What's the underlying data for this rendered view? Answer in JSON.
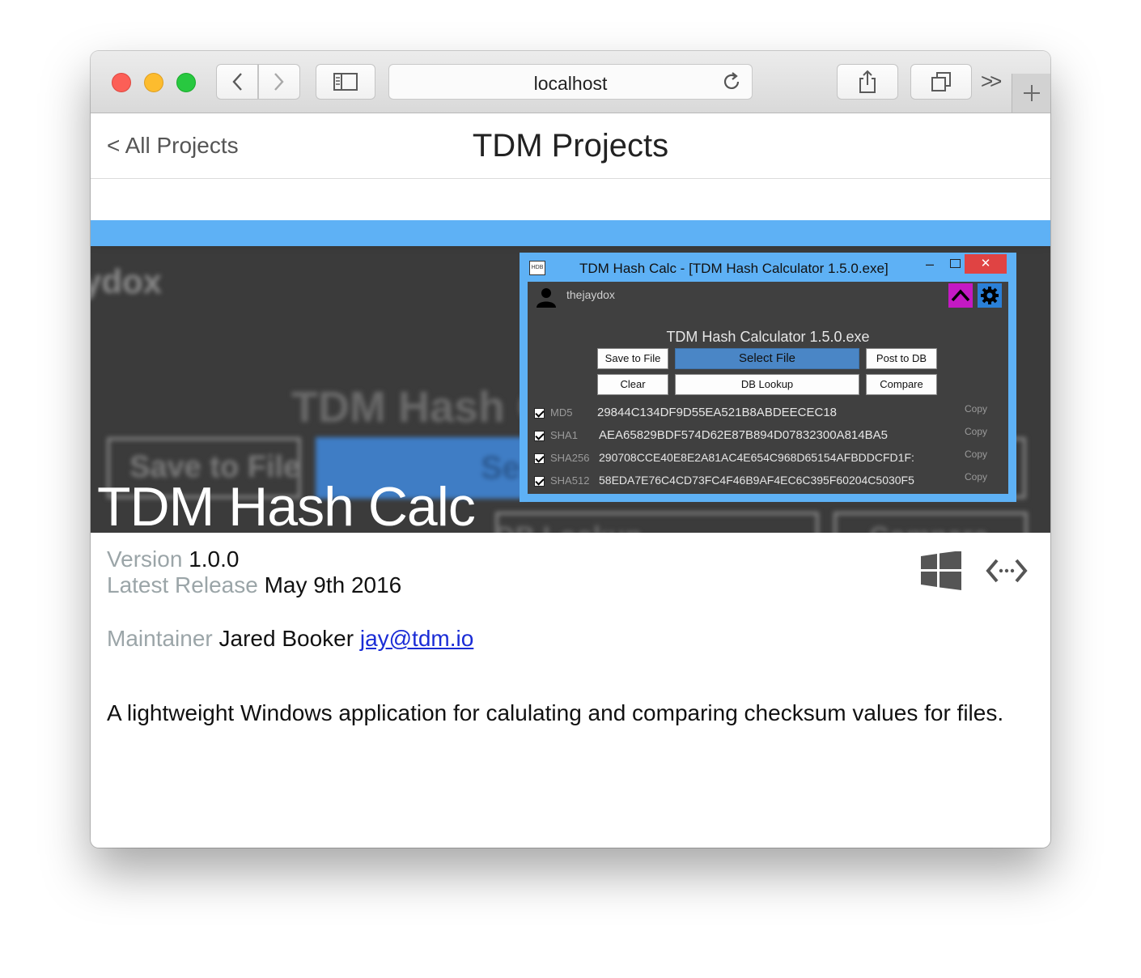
{
  "browser": {
    "url": "localhost"
  },
  "header": {
    "back_label": "< All Projects",
    "site_title": "TDM Projects"
  },
  "hero": {
    "title": "TDM Hash Calc",
    "background_partial_text": {
      "username": "ydox",
      "title": "TDM Hash C",
      "button": "Save to File",
      "button2": "Se",
      "button3": "DB Lookup",
      "button4": "Compare"
    }
  },
  "app_window": {
    "title": "TDM Hash Calc - [TDM Hash Calculator 1.5.0.exe]",
    "icon_text": "HDB",
    "close_glyph": "✕",
    "user": "thejaydox",
    "file_name": "TDM Hash Calculator 1.5.0.exe",
    "buttons": {
      "save_to_file": "Save to File",
      "select_file": "Select File",
      "post_to_db": "Post to DB",
      "clear": "Clear",
      "db_lookup": "DB Lookup",
      "compare": "Compare"
    },
    "hashes": [
      {
        "label": "MD5",
        "value": "29844C134DF9D55EA521B8ABDEECEC18",
        "copy": "Copy"
      },
      {
        "label": "SHA1",
        "value": "AEA65829BDF574D62E87B894D07832300A814BA5",
        "copy": "Copy"
      },
      {
        "label": "SHA256",
        "value": "290708CCE40E8E2A81AC4E654C968D65154AFBDDCFD1F:",
        "copy": "Copy"
      },
      {
        "label": "SHA512",
        "value": "58EDA7E76C4CD73FC4F46B9AF4EC6C395F60204C5030F5",
        "copy": "Copy"
      }
    ]
  },
  "details": {
    "version_label": "Version",
    "version_value": "1.0.0",
    "release_label": "Latest Release",
    "release_value": "May 9th 2016",
    "maintainer_label": "Maintainer",
    "maintainer_name": "Jared Booker",
    "maintainer_email": "jay@tdm.io",
    "description": "A lightweight Windows application for calulating and comparing checksum values for files."
  },
  "icons": {
    "windows": "windows-icon",
    "source": "source-code-icon"
  },
  "colors": {
    "accent_blue": "#5eb1f5",
    "app_bg": "#404040",
    "link": "#1a2cd6",
    "muted_text": "#9ba5a8"
  }
}
